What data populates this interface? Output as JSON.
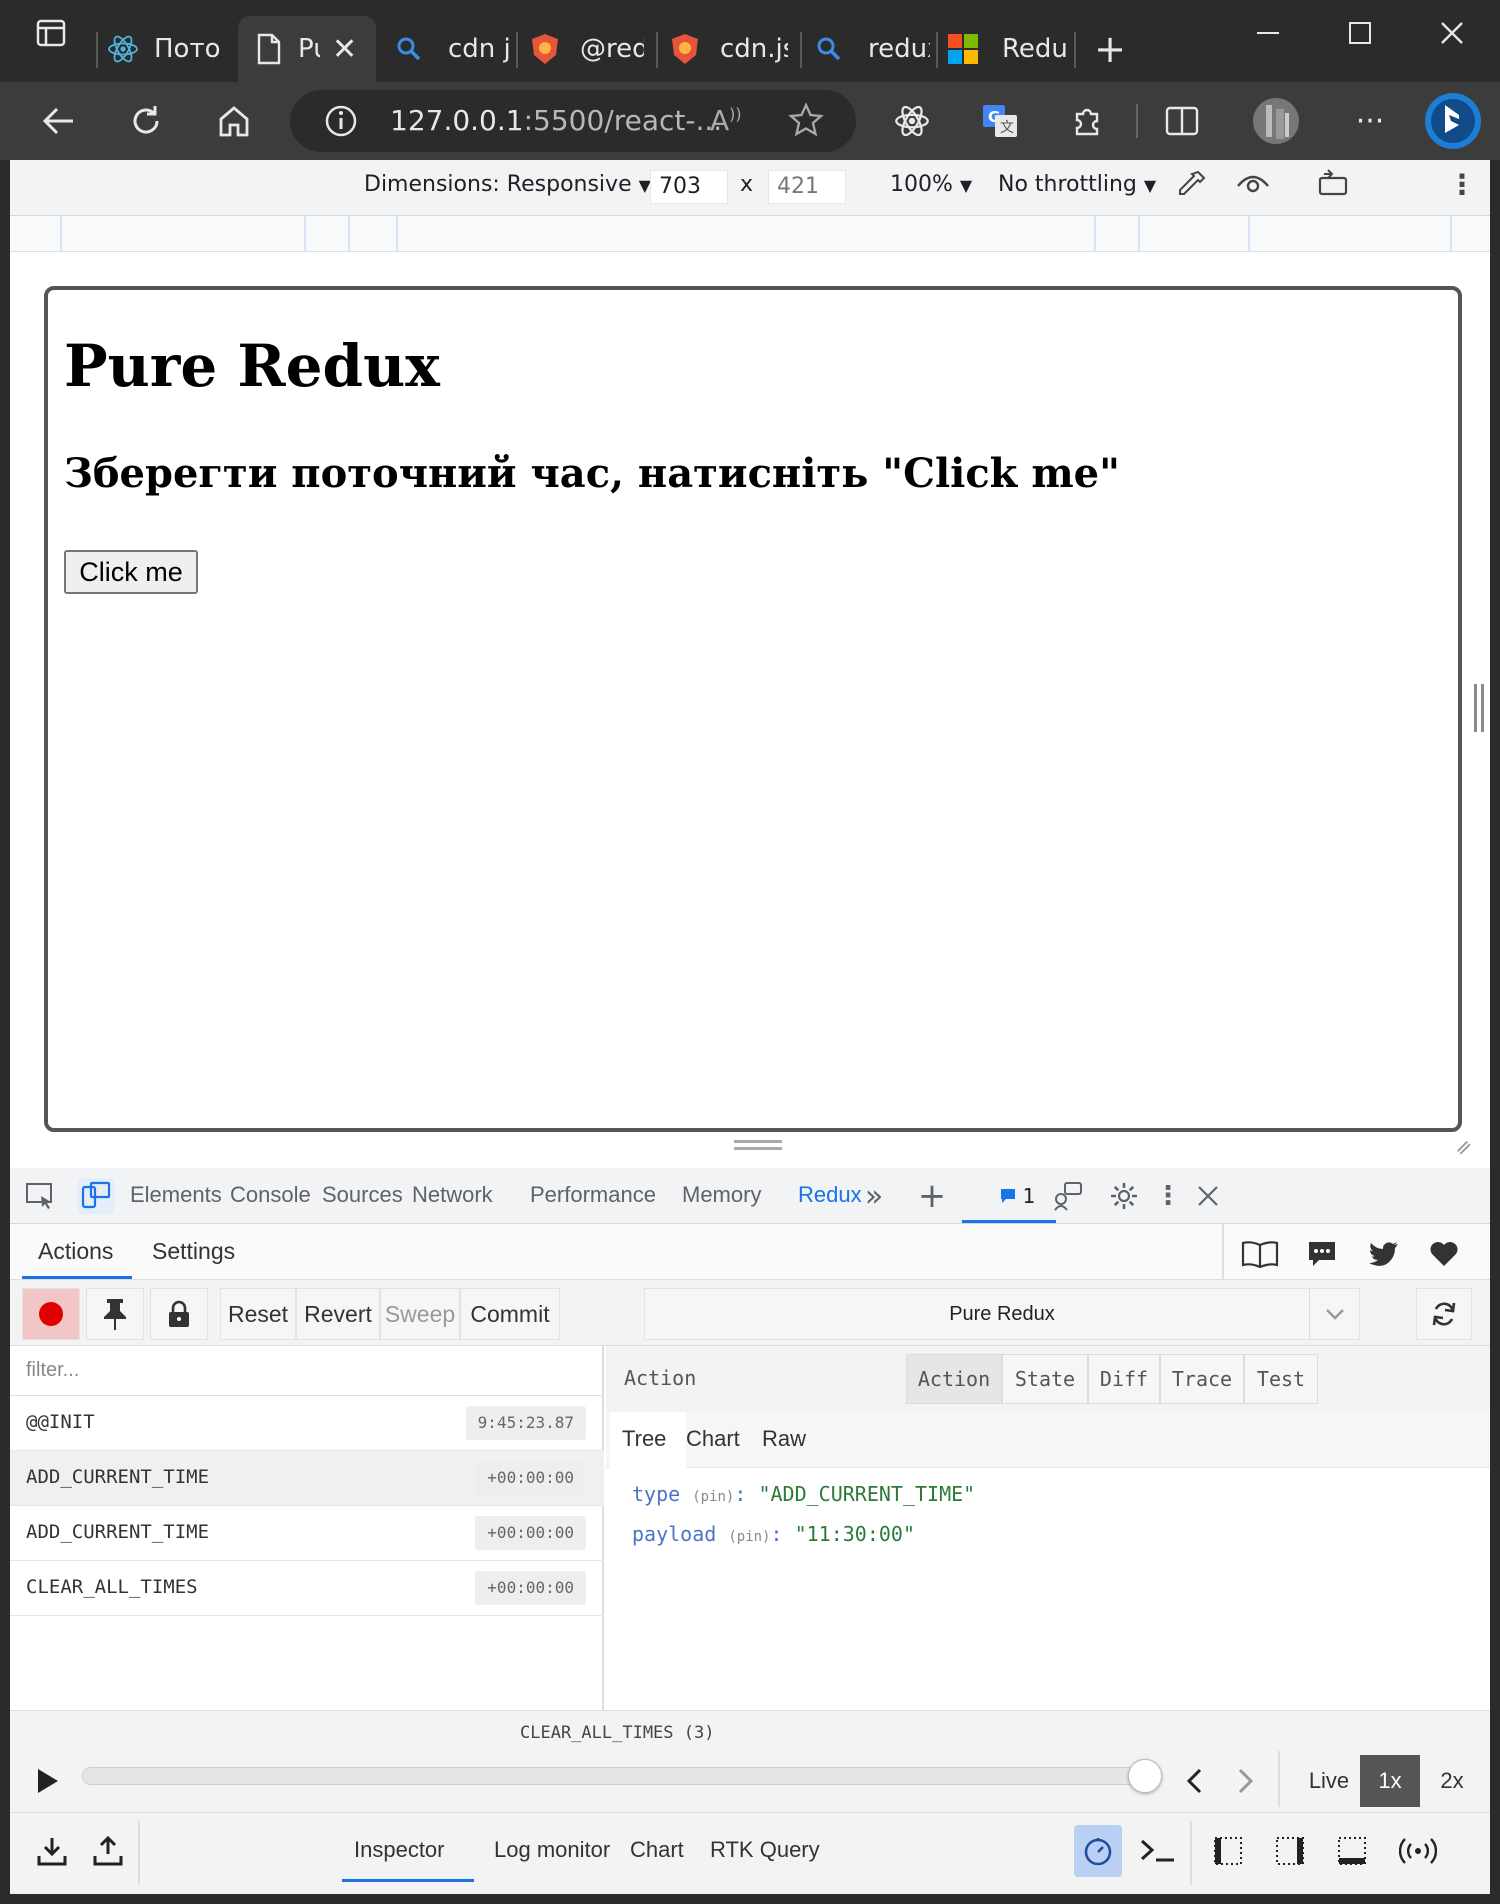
{
  "browser": {
    "tabs": [
      {
        "label": "Поток",
        "favicon": "react-icon"
      },
      {
        "label": "Pure Redux",
        "favicon": "page-icon"
      },
      {
        "label": "cdn js",
        "favicon": "search-icon"
      },
      {
        "label": "@redu",
        "favicon": "shield-icon"
      },
      {
        "label": "cdn.jsd",
        "favicon": "shield-icon"
      },
      {
        "label": "redux",
        "favicon": "search-icon"
      },
      {
        "label": "Redux",
        "favicon": "microsoft-icon"
      }
    ],
    "url_host": "127.0.0.1",
    "url_rest": ":5500/react-..."
  },
  "device_toolbar": {
    "dimensions_label": "Dimensions: Responsive",
    "width": "703",
    "times": "x",
    "height": "421",
    "zoom": "100%",
    "throttling": "No throttling"
  },
  "page": {
    "h1": "Pure Redux",
    "h2": "Зберегти поточний час, натисніть \"Click me\"",
    "button_label": "Click me"
  },
  "devtools_tabs": {
    "elements": "Elements",
    "console": "Console",
    "sources": "Sources",
    "network": "Network",
    "performance": "Performance",
    "memory": "Memory",
    "redux": "Redux",
    "issues_count": "1"
  },
  "redux": {
    "nav": {
      "actions": "Actions",
      "settings": "Settings"
    },
    "toolbar": {
      "reset": "Reset",
      "revert": "Revert",
      "sweep": "Sweep",
      "commit": "Commit",
      "instance": "Pure Redux"
    },
    "filter_placeholder": "filter...",
    "actions": [
      {
        "name": "@@INIT",
        "time": "9:45:23.87"
      },
      {
        "name": "ADD_CURRENT_TIME",
        "time": "+00:00:00"
      },
      {
        "name": "ADD_CURRENT_TIME",
        "time": "+00:00:00"
      },
      {
        "name": "CLEAR_ALL_TIMES",
        "time": "+00:00:00"
      }
    ],
    "detail": {
      "title": "Action",
      "tabs": [
        "Action",
        "State",
        "Diff",
        "Trace",
        "Test"
      ],
      "subtabs": [
        "Tree",
        "Chart",
        "Raw"
      ],
      "tree": {
        "type_key": "type",
        "type_pin": "(pin)",
        "type_val": "\"ADD_CURRENT_TIME\"",
        "payload_key": "payload",
        "payload_pin": "(pin)",
        "payload_val": "\"11:30:00\""
      }
    },
    "slider": {
      "label": "CLEAR_ALL_TIMES (3)",
      "live": "Live",
      "speed_1x": "1x",
      "speed_2x": "2x",
      "position": 1.0
    },
    "monitors": [
      "Inspector",
      "Log monitor",
      "Chart",
      "RTK Query"
    ]
  }
}
